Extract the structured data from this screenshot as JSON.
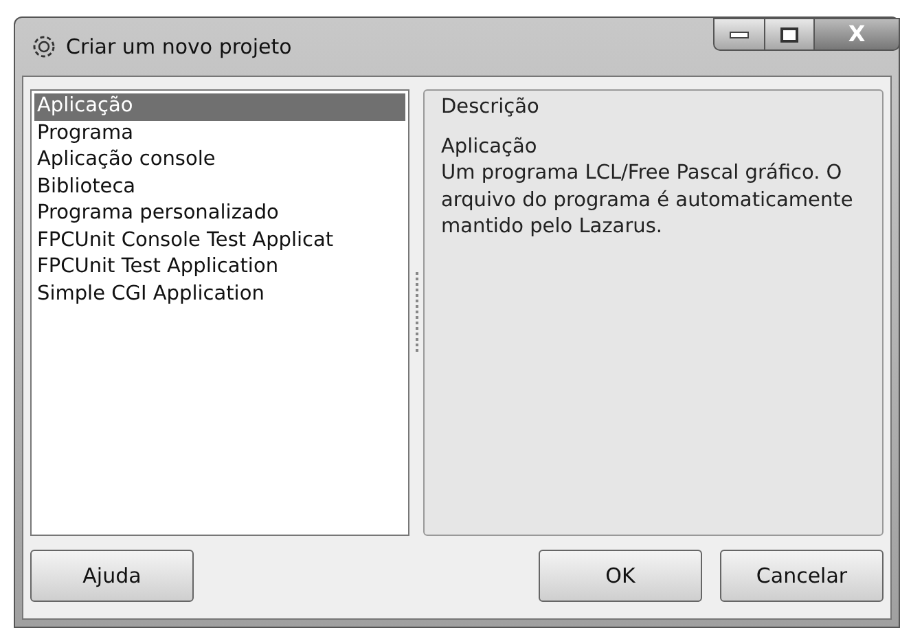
{
  "window": {
    "title": "Criar um novo projeto",
    "controls": [
      {
        "kind": "minimize"
      },
      {
        "kind": "maximize"
      },
      {
        "kind": "close",
        "label": "X"
      }
    ]
  },
  "project_types": [
    {
      "label": "Aplicação",
      "selected": true
    },
    {
      "label": "Programa",
      "selected": false
    },
    {
      "label": "Aplicação console",
      "selected": false
    },
    {
      "label": "Biblioteca",
      "selected": false
    },
    {
      "label": "Programa personalizado",
      "selected": false
    },
    {
      "label": "FPCUnit Console Test Applicat",
      "selected": false
    },
    {
      "label": "FPCUnit Test Application",
      "selected": false
    },
    {
      "label": "Simple CGI Application",
      "selected": false
    }
  ],
  "description": {
    "title": "Descrição",
    "heading": "Aplicação",
    "text": "Um programa LCL/Free Pascal gráfico. O arquivo do programa é automaticamente mantido pelo Lazarus."
  },
  "buttons": {
    "help": "Ajuda",
    "ok": "OK",
    "cancel": "Cancelar"
  }
}
